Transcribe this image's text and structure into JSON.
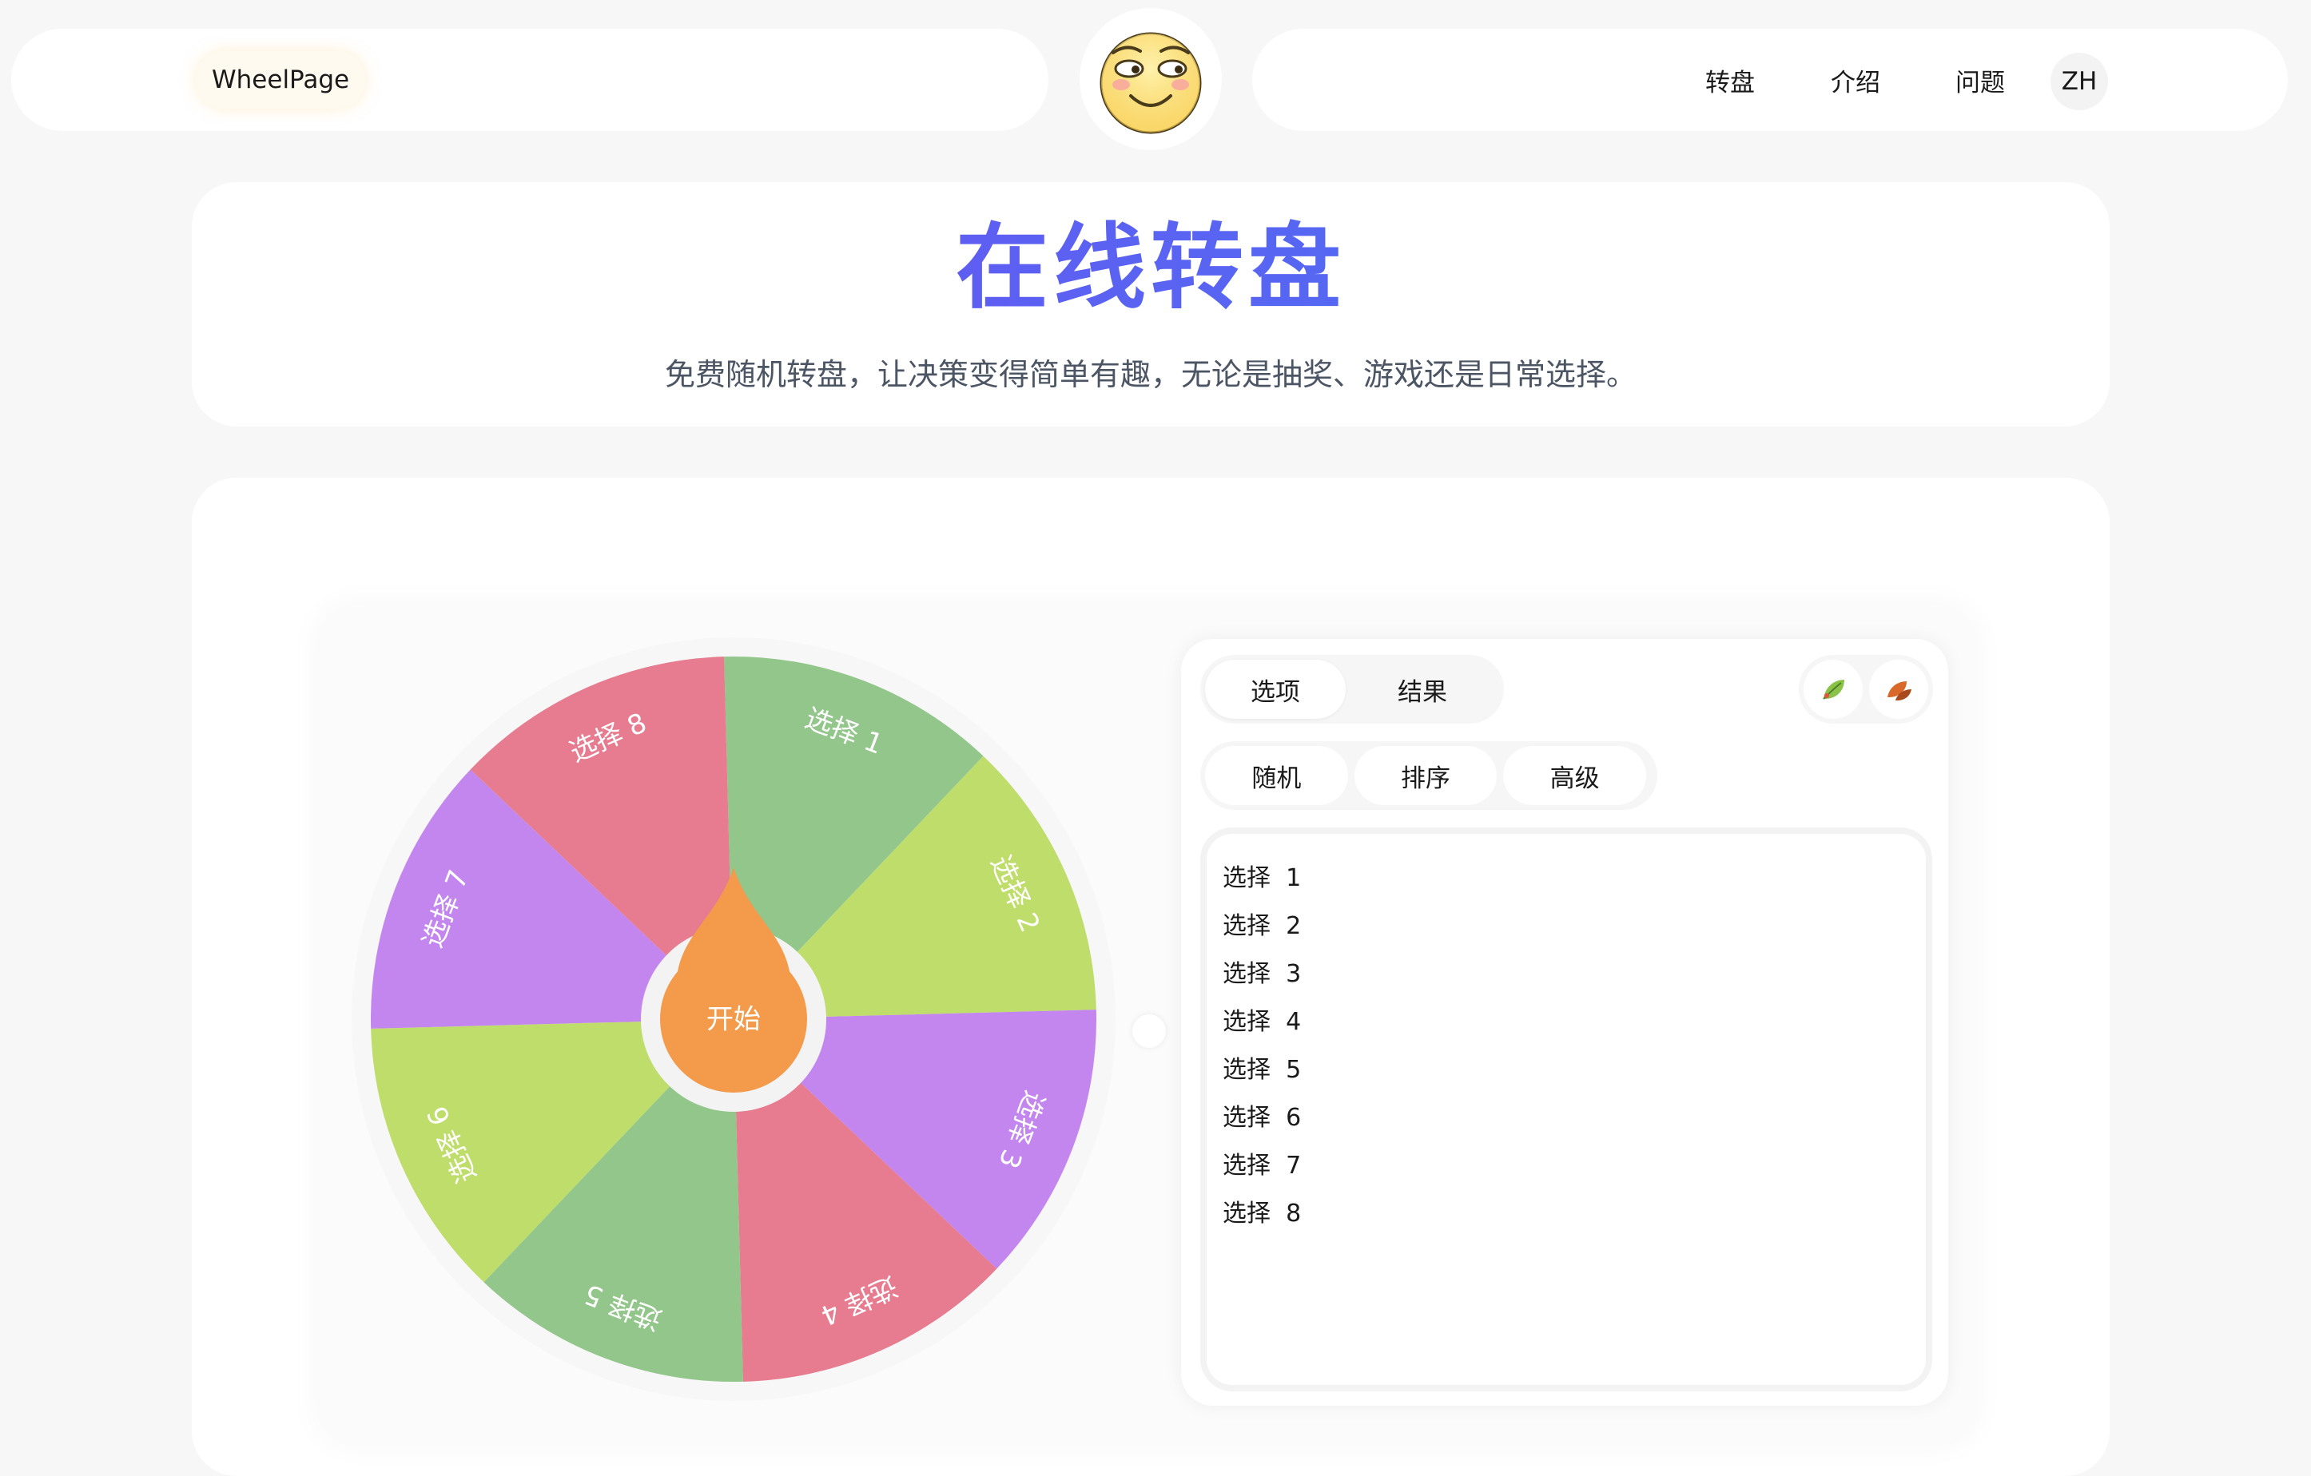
{
  "header": {
    "logo_text": "WheelPage",
    "mascot": "smiling-face-icon",
    "nav": [
      "转盘",
      "介绍",
      "问题"
    ],
    "lang": "ZH"
  },
  "hero": {
    "title": "在线转盘",
    "subtitle": "免费随机转盘，让决策变得简单有趣，无论是抽奖、游戏还是日常选择。"
  },
  "wheel": {
    "start_label": "开始",
    "pointer_color": "#f39a4b",
    "segments": [
      {
        "label": "选择 1",
        "color": "#93c68b"
      },
      {
        "label": "选择 2",
        "color": "#bfdd6a"
      },
      {
        "label": "选择 3",
        "color": "#c386ef"
      },
      {
        "label": "选择 4",
        "color": "#e77b8f"
      },
      {
        "label": "选择 5",
        "color": "#93c68b"
      },
      {
        "label": "选择 6",
        "color": "#bfdd6a"
      },
      {
        "label": "选择 7",
        "color": "#c386ef"
      },
      {
        "label": "选择 8",
        "color": "#e77b8f"
      }
    ]
  },
  "panel": {
    "tabs": [
      "选项",
      "结果"
    ],
    "modes": [
      "随机",
      "排序",
      "高级"
    ],
    "icon_buttons": [
      "leaf-icon",
      "fallen-leaves-icon"
    ],
    "options": [
      "选择  1",
      "选择  2",
      "选择  3",
      "选择  4",
      "选择  5",
      "选择  6",
      "选择  7",
      "选择  8"
    ]
  }
}
